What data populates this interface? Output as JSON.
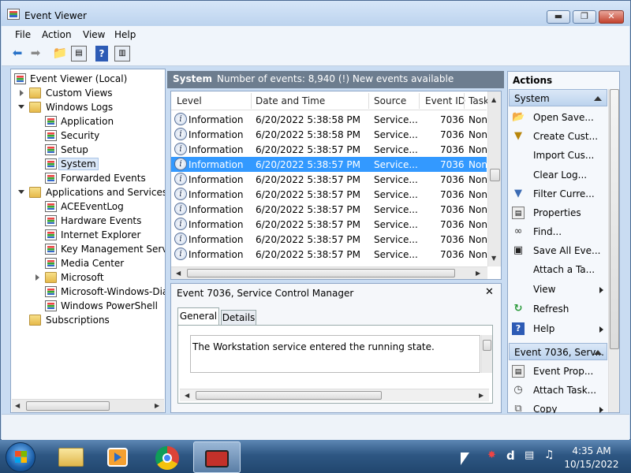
{
  "window": {
    "title": "Event Viewer",
    "minimize": "▬",
    "maximize": "❐",
    "close": "✕"
  },
  "menu": [
    "File",
    "Action",
    "View",
    "Help"
  ],
  "tree": {
    "root": "Event Viewer (Local)",
    "custom_views": "Custom Views",
    "windows_logs": "Windows Logs",
    "logs": [
      "Application",
      "Security",
      "Setup",
      "System",
      "Forwarded Events"
    ],
    "apps_services": "Applications and Services Lo",
    "app_logs": [
      "ACEEventLog",
      "Hardware Events",
      "Internet Explorer",
      "Key Management Service",
      "Media Center",
      "Microsoft",
      "Microsoft-Windows-Diag",
      "Windows PowerShell"
    ],
    "subscriptions": "Subscriptions"
  },
  "main_header": {
    "title": "System",
    "info": "Number of events: 8,940 (!) New events available"
  },
  "columns": [
    "Level",
    "Date and Time",
    "Source",
    "Event ID",
    "Task"
  ],
  "events": [
    {
      "level": "Information",
      "date": "6/20/2022 5:38:58 PM",
      "source": "Service...",
      "id": "7036",
      "task": "Non"
    },
    {
      "level": "Information",
      "date": "6/20/2022 5:38:58 PM",
      "source": "Service...",
      "id": "7036",
      "task": "Non"
    },
    {
      "level": "Information",
      "date": "6/20/2022 5:38:57 PM",
      "source": "Service...",
      "id": "7036",
      "task": "Non"
    },
    {
      "level": "Information",
      "date": "6/20/2022 5:38:57 PM",
      "source": "Service...",
      "id": "7036",
      "task": "Non"
    },
    {
      "level": "Information",
      "date": "6/20/2022 5:38:57 PM",
      "source": "Service...",
      "id": "7036",
      "task": "Non"
    },
    {
      "level": "Information",
      "date": "6/20/2022 5:38:57 PM",
      "source": "Service...",
      "id": "7036",
      "task": "Non"
    },
    {
      "level": "Information",
      "date": "6/20/2022 5:38:57 PM",
      "source": "Service...",
      "id": "7036",
      "task": "Non"
    },
    {
      "level": "Information",
      "date": "6/20/2022 5:38:57 PM",
      "source": "Service...",
      "id": "7036",
      "task": "Non"
    },
    {
      "level": "Information",
      "date": "6/20/2022 5:38:57 PM",
      "source": "Service...",
      "id": "7036",
      "task": "Non"
    },
    {
      "level": "Information",
      "date": "6/20/2022 5:38:57 PM",
      "source": "Service...",
      "id": "7036",
      "task": "Non"
    }
  ],
  "detail": {
    "title": "Event 7036, Service Control Manager",
    "close": "✕",
    "tabs": [
      "General",
      "Details"
    ],
    "message": "The Workstation service entered the running state."
  },
  "actions": {
    "title": "Actions",
    "section1": "System",
    "items1": [
      "Open Save...",
      "Create Cust...",
      "Import Cus...",
      "Clear Log...",
      "Filter Curre...",
      "Properties",
      "Find...",
      "Save All Eve...",
      "Attach a Ta...",
      "View",
      "Refresh",
      "Help"
    ],
    "section2": "Event 7036, Serv...",
    "items2": [
      "Event Prop...",
      "Attach Task...",
      "Copy"
    ]
  },
  "taskbar": {
    "time": "4:35 AM",
    "date": "10/15/2022"
  },
  "colors": {
    "selection": "#3399ff",
    "header": "#6d7d8f"
  }
}
